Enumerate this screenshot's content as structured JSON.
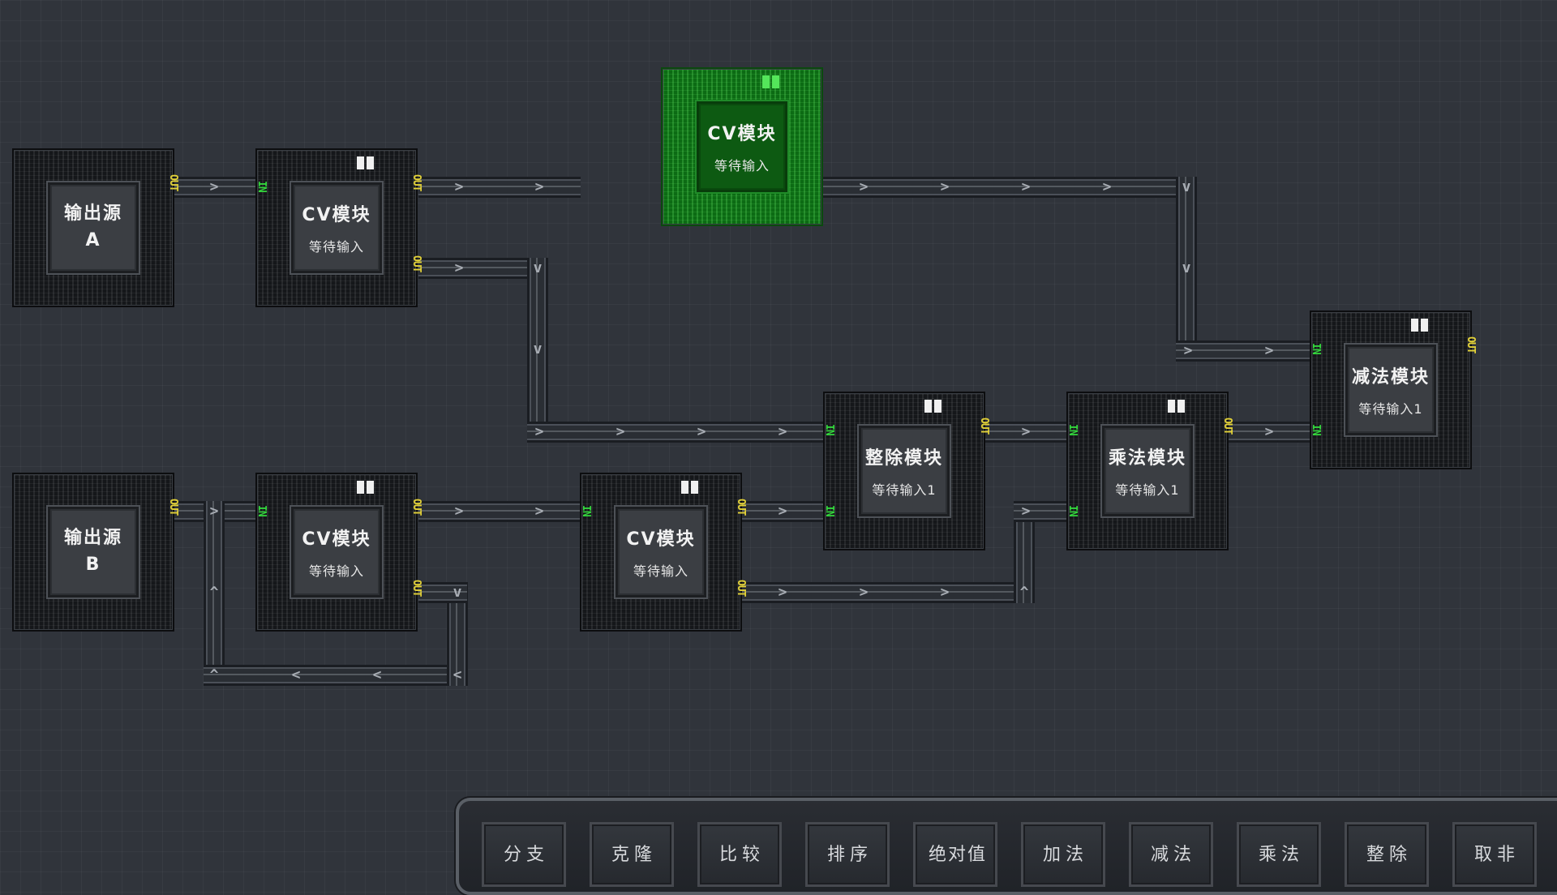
{
  "modules": {
    "source_a": {
      "title": "输出源",
      "letter": "A"
    },
    "source_b": {
      "title": "输出源",
      "letter": "B"
    },
    "cv1": {
      "title": "CV模块",
      "status": "等待输入"
    },
    "cv2": {
      "title": "CV模块",
      "status": "等待输入"
    },
    "cv3": {
      "title": "CV模块",
      "status": "等待输入"
    },
    "cv_selected": {
      "title": "CV模块",
      "status": "等待输入"
    },
    "divide": {
      "title": "整除模块",
      "status": "等待输入1"
    },
    "multiply": {
      "title": "乘法模块",
      "status": "等待输入1"
    },
    "subtract": {
      "title": "减法模块",
      "status": "等待输入1"
    }
  },
  "ports": {
    "out": "OUT",
    "in": "IN"
  },
  "toolbar": {
    "buttons": [
      "分支",
      "克隆",
      "比较",
      "排序",
      "绝对值",
      "加法",
      "减法",
      "乘法",
      "整除",
      "取非"
    ]
  },
  "colors": {
    "selected_module": "#0c6b14",
    "out_port": "#e3d238",
    "in_port": "#33d63c"
  }
}
